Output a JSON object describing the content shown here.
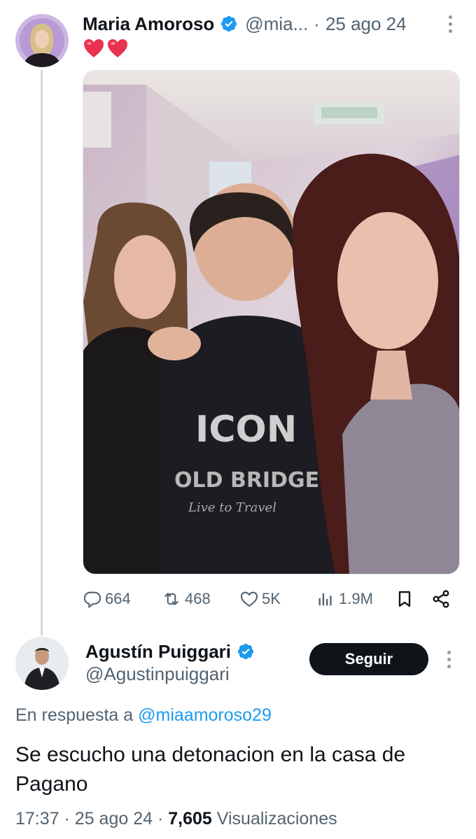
{
  "tweet": {
    "author_name": "Maria Amoroso",
    "handle": "@mia...",
    "separator": "·",
    "date": "25 ago 24",
    "text_emoji": "❤️❤️",
    "stats": {
      "replies": "664",
      "retweets": "468",
      "likes": "5K",
      "views": "1.9M"
    }
  },
  "reply": {
    "author_name": "Agustín Puiggari",
    "handle": "@Agustinpuiggari",
    "follow_label": "Seguir",
    "reply_prefix": "En respuesta a",
    "reply_mention": "@miaamoroso29",
    "text": "Se escucho una detonacion en la casa de Pagano",
    "time": "17:37",
    "date": "25 ago 24",
    "separator": "·",
    "views_count": "7,605",
    "views_label": "Visualizaciones"
  },
  "colors": {
    "text_primary": "#0f1419",
    "text_secondary": "#536471",
    "accent": "#1d9bf0",
    "thread_line": "#cfd9de",
    "heart": "#e8324f"
  },
  "icons": {
    "verified": "verified-badge-icon",
    "reply": "comment-icon",
    "retweet": "retweet-icon",
    "like": "heart-icon",
    "views": "bar-chart-icon",
    "bookmark": "bookmark-icon",
    "share": "share-icon",
    "more": "more-dots-icon"
  }
}
